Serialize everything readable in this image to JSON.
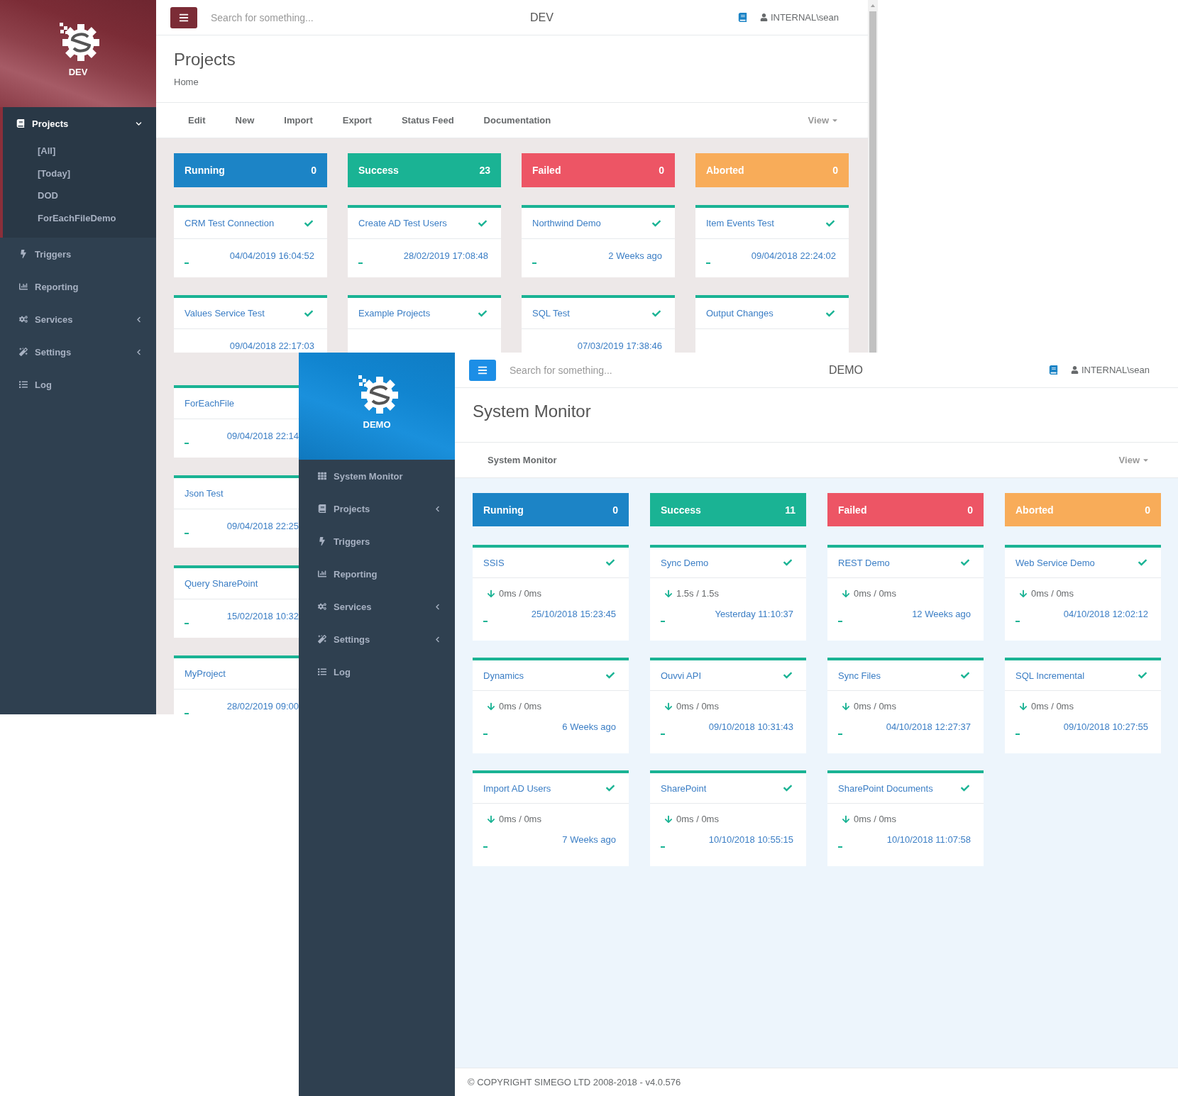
{
  "dev_window": {
    "kind": "dev",
    "logo_label": "DEV",
    "sidebar": {
      "items": [
        {
          "kind": "projects",
          "label": "Projects",
          "selected": true,
          "submenu": true,
          "expanded": true,
          "children": [
            {
              "label": "[All]"
            },
            {
              "label": "[Today]"
            },
            {
              "label": "DOD"
            },
            {
              "label": "ForEachFileDemo"
            }
          ]
        },
        {
          "kind": "triggers",
          "label": "Triggers",
          "selected": false,
          "submenu": false
        },
        {
          "kind": "reporting",
          "label": "Reporting",
          "selected": false,
          "submenu": false
        },
        {
          "kind": "services",
          "label": "Services",
          "selected": false,
          "submenu": true,
          "expanded": false
        },
        {
          "kind": "settings",
          "label": "Settings",
          "selected": false,
          "submenu": true,
          "expanded": false
        },
        {
          "kind": "log",
          "label": "Log",
          "selected": false,
          "submenu": false
        }
      ]
    },
    "topbar": {
      "search_placeholder": "Search for something...",
      "environment": "DEV",
      "user": "INTERNAL\\sean"
    },
    "page_header": {
      "title": "Projects",
      "breadcrumb": "Home"
    },
    "toolbar": {
      "items": [
        "Edit",
        "New",
        "Import",
        "Export",
        "Status Feed",
        "Documentation"
      ],
      "view": "View"
    },
    "tiles": [
      {
        "kind": "running",
        "label": "Running",
        "count": "0"
      },
      {
        "kind": "success",
        "label": "Success",
        "count": "23"
      },
      {
        "kind": "failed",
        "label": "Failed",
        "count": "0"
      },
      {
        "kind": "aborted",
        "label": "Aborted",
        "count": "0"
      }
    ],
    "cards": [
      {
        "name": "CRM Test Connection",
        "tick": true,
        "date": "04/04/2019 16:04:52"
      },
      {
        "name": "Create AD Test Users",
        "tick": true,
        "date": "28/02/2019 17:08:48"
      },
      {
        "name": "Northwind Demo",
        "tick": true,
        "date": "2 Weeks ago"
      },
      {
        "name": "Item Events Test",
        "tick": true,
        "date": "09/04/2018 22:24:02"
      },
      {
        "name": "Values Service Test",
        "tick": true,
        "date": "09/04/2018 22:17:03"
      },
      {
        "name": "Example Projects",
        "tick": true
      },
      {
        "name": "SQL Test",
        "tick": true,
        "date": "07/03/2019 17:38:46"
      },
      {
        "name": "Output Changes",
        "tick": true
      },
      {
        "name": "ForEachFile",
        "tick": false,
        "date": "09/04/2018 22:14"
      },
      {
        "name": "Json Test",
        "tick": false,
        "date": "09/04/2018 22:25"
      },
      {
        "name": "Query SharePoint",
        "tick": false,
        "date": "15/02/2018 10:32"
      },
      {
        "name": "MyProject",
        "tick": false,
        "date": "28/02/2019 09:00"
      }
    ]
  },
  "demo_window": {
    "kind": "demo",
    "logo_label": "DEMO",
    "sidebar": {
      "items": [
        {
          "kind": "monitor",
          "label": "System Monitor",
          "selected": false,
          "submenu": false
        },
        {
          "kind": "projects",
          "label": "Projects",
          "selected": false,
          "submenu": true,
          "expanded": false
        },
        {
          "kind": "triggers",
          "label": "Triggers",
          "selected": false,
          "submenu": false
        },
        {
          "kind": "reporting",
          "label": "Reporting",
          "selected": false,
          "submenu": false
        },
        {
          "kind": "services",
          "label": "Services",
          "selected": false,
          "submenu": true,
          "expanded": false
        },
        {
          "kind": "settings",
          "label": "Settings",
          "selected": false,
          "submenu": true,
          "expanded": false
        },
        {
          "kind": "log",
          "label": "Log",
          "selected": false,
          "submenu": false
        }
      ]
    },
    "topbar": {
      "search_placeholder": "Search for something...",
      "environment": "DEMO",
      "user": "INTERNAL\\sean"
    },
    "page_header": {
      "title": "System Monitor"
    },
    "toolbar": {
      "items": [
        "System Monitor"
      ],
      "view": "View"
    },
    "tiles": [
      {
        "kind": "running",
        "label": "Running",
        "count": "0"
      },
      {
        "kind": "success",
        "label": "Success",
        "count": "11"
      },
      {
        "kind": "failed",
        "label": "Failed",
        "count": "0"
      },
      {
        "kind": "aborted",
        "label": "Aborted",
        "count": "0"
      }
    ],
    "cards": [
      {
        "name": "SSIS",
        "tick": true,
        "timing": "0ms / 0ms",
        "date": "25/10/2018 15:23:45"
      },
      {
        "name": "Sync Demo",
        "tick": true,
        "timing": "1.5s / 1.5s",
        "date": "Yesterday 11:10:37"
      },
      {
        "name": "REST Demo",
        "tick": true,
        "timing": "0ms / 0ms",
        "date": "12 Weeks ago"
      },
      {
        "name": "Web Service Demo",
        "tick": true,
        "timing": "0ms / 0ms",
        "date": "04/10/2018 12:02:12"
      },
      {
        "name": "Dynamics",
        "tick": true,
        "timing": "0ms / 0ms",
        "date": "6 Weeks ago"
      },
      {
        "name": "Ouvvi API",
        "tick": true,
        "timing": "0ms / 0ms",
        "date": "09/10/2018 10:31:43"
      },
      {
        "name": "Sync Files",
        "tick": true,
        "timing": "0ms / 0ms",
        "date": "04/10/2018 12:27:37"
      },
      {
        "name": "SQL Incremental",
        "tick": true,
        "timing": "0ms / 0ms",
        "date": "09/10/2018 10:27:55"
      },
      {
        "name": "Import AD Users",
        "tick": true,
        "timing": "0ms / 0ms",
        "date": "7 Weeks ago"
      },
      {
        "name": "SharePoint",
        "tick": true,
        "timing": "0ms / 0ms",
        "date": "10/10/2018 10:55:15"
      },
      {
        "name": "SharePoint Documents",
        "tick": true,
        "timing": "0ms / 0ms",
        "date": "10/10/2018 11:07:58"
      }
    ],
    "footer": "© COPYRIGHT SIMEGO LTD 2008-2018 - v4.0.576"
  }
}
